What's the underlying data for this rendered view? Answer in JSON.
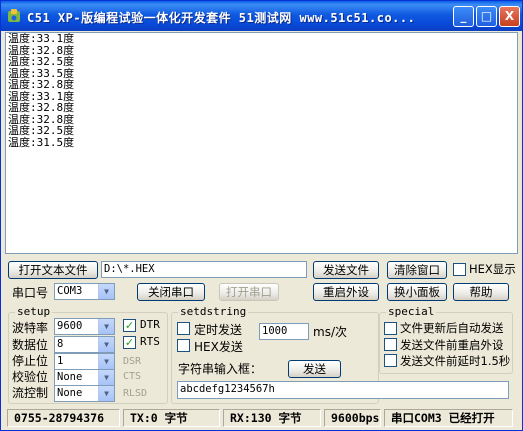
{
  "window": {
    "title": "C51 XP-版编程试验一体化开发套件 51测试网 www.51c51.co...",
    "minimize": "_",
    "maximize": "□",
    "close": "X"
  },
  "output": {
    "lines": [
      "温度:33.1度",
      "温度:32.8度",
      "温度:32.5度",
      "温度:33.5度",
      "温度:32.8度",
      "温度:33.1度",
      "温度:32.8度",
      "温度:32.8度",
      "温度:32.5度",
      "温度:31.5度"
    ]
  },
  "toolbar": {
    "open_file": "打开文本文件",
    "file_path": "D:\\*.HEX",
    "send_file": "发送文件",
    "clear_window": "清除窗口",
    "hex_display": "HEX显示",
    "port_label": "串口号",
    "port_value": "COM3",
    "close_port": "关闭串口",
    "open_port": "打开串口",
    "restart_ext": "重启外设",
    "switch_panel": "换小面板",
    "help": "帮助"
  },
  "setup": {
    "title": "setup",
    "baud_label": "波特率",
    "baud_value": "9600",
    "data_bits_label": "数据位",
    "data_bits_value": "8",
    "stop_bits_label": "停止位",
    "stop_bits_value": "1",
    "parity_label": "校验位",
    "parity_value": "None",
    "flow_label": "流控制",
    "flow_value": "None",
    "dtr": "DTR",
    "rts": "RTS",
    "dsr": "DSR",
    "cts": "CTS",
    "rlsd": "RLSD"
  },
  "setdstring": {
    "title": "setdstring",
    "timed_send": "定时发送",
    "interval_value": "1000",
    "interval_unit": "ms/次",
    "hex_send": "HEX发送",
    "input_label": "字符串输入框：",
    "send_button": "发送",
    "input_value": "abcdefg1234567h"
  },
  "special": {
    "title": "special",
    "opt1": "文件更新后自动发送",
    "opt2": "发送文件前重启外设",
    "opt3": "发送文件前延时1.5秒"
  },
  "status": {
    "phone": "0755-28794376",
    "tx": "TX:0 字节",
    "rx": "RX:130 字节",
    "baud": "9600bps",
    "port_state": "串口COM3 已经打开"
  },
  "colors": {
    "title_bar": "#0A5FE6",
    "window_bg": "#ECE9D8",
    "checkmark": "#21A121"
  }
}
